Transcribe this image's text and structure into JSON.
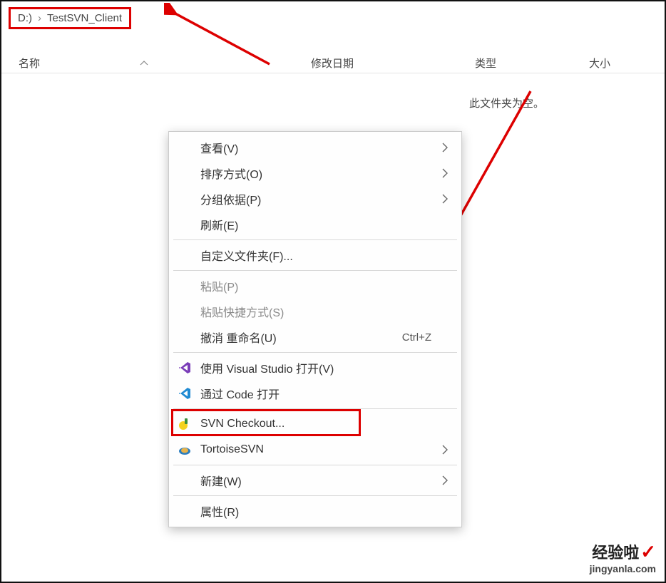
{
  "breadcrumb": {
    "drive": "D:)",
    "sep": "›",
    "folder": "TestSVN_Client"
  },
  "columns": {
    "name": "名称",
    "date": "修改日期",
    "type": "类型",
    "size": "大小"
  },
  "empty_msg": "此文件夹为空。",
  "menu": {
    "view": "查看(V)",
    "sort": "排序方式(O)",
    "group": "分组依据(P)",
    "refresh": "刷新(E)",
    "customize": "自定义文件夹(F)...",
    "paste": "粘贴(P)",
    "paste_shortcut": "粘贴快捷方式(S)",
    "undo_rename": "撤消 重命名(U)",
    "undo_shortcut": "Ctrl+Z",
    "open_vs": "使用 Visual Studio 打开(V)",
    "open_code": "通过 Code 打开",
    "svn_checkout": "SVN Checkout...",
    "tortoise": "TortoiseSVN",
    "new": "新建(W)",
    "properties": "属性(R)"
  },
  "watermark": {
    "line1": "经验啦",
    "line2": "jingyanla.com"
  }
}
